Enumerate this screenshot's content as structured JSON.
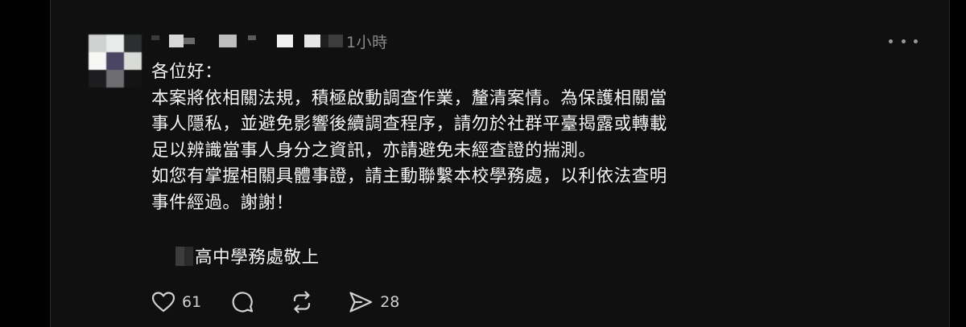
{
  "post": {
    "timestamp": "1小時",
    "body_lines": [
      "各位好：",
      "本案將依相關法規，積極啟動調查作業，釐清案情。為保護相關當",
      "事人隱私，並避免影響後續調查程序，請勿於社群平臺揭露或轉載",
      "足以辨識當事人身分之資訊，亦請避免未經查證的揣測。",
      "如您有掌握相關具體事證，請主動聯繫本校學務處，以利依法查明",
      "事件經過。謝謝！"
    ],
    "signature": "高中學務處敬上"
  },
  "actions": {
    "like_count": "61",
    "share_count": "28"
  },
  "icons": {
    "more": "more-horizontal-icon",
    "like": "heart-icon",
    "comment": "comment-icon",
    "repost": "repost-icon",
    "share": "send-icon"
  },
  "colors": {
    "background": "#101010",
    "text": "#f3f5f7",
    "muted": "#8b8b8b"
  }
}
